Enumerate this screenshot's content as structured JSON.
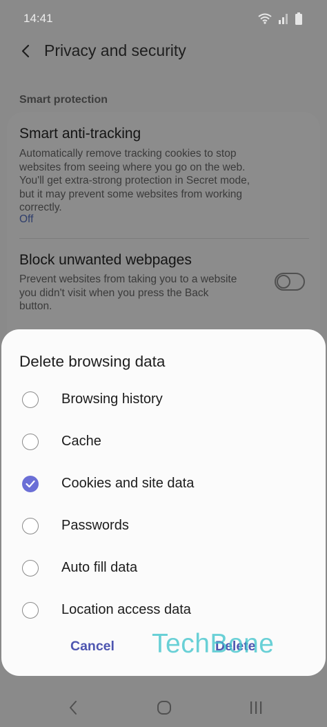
{
  "status_bar": {
    "time": "14:41"
  },
  "app_bar": {
    "title": "Privacy and security"
  },
  "section": {
    "header": "Smart protection"
  },
  "settings": [
    {
      "title": "Smart anti-tracking",
      "description_lines": [
        "Automatically remove tracking cookies to stop",
        "websites from seeing where you go on the web.",
        "You'll get extra-strong protection in Secret mode,",
        "but it may prevent some websites from working",
        "correctly."
      ],
      "value": "Off"
    },
    {
      "title": "Block unwanted webpages",
      "description_lines": [
        "Prevent websites from taking you to a website",
        "you didn't visit when you press the Back",
        "button."
      ],
      "toggle_on": false
    }
  ],
  "dialog": {
    "title": "Delete browsing data",
    "options": [
      {
        "label": "Browsing history",
        "checked": false
      },
      {
        "label": "Cache",
        "checked": false
      },
      {
        "label": "Cookies and site data",
        "checked": true
      },
      {
        "label": "Passwords",
        "checked": false
      },
      {
        "label": "Auto fill data",
        "checked": false
      },
      {
        "label": "Location access data",
        "checked": false
      }
    ],
    "cancel_label": "Cancel",
    "delete_label": "Delete"
  },
  "watermark": "TechBone",
  "colors": {
    "accent": "#6b6fd6",
    "button_text": "#4d55b0",
    "watermark": "#40c4cc",
    "scrim": "#8a8a8a",
    "dialog_bg": "#fbfbfb"
  },
  "icons": {
    "back": "chevron-left-icon",
    "wifi": "wifi-icon",
    "signal": "signal-icon",
    "battery": "battery-icon",
    "checkmark": "checkmark-icon",
    "nav_back": "nav-back-icon",
    "nav_home": "nav-home-icon",
    "nav_recents": "nav-recents-icon"
  }
}
